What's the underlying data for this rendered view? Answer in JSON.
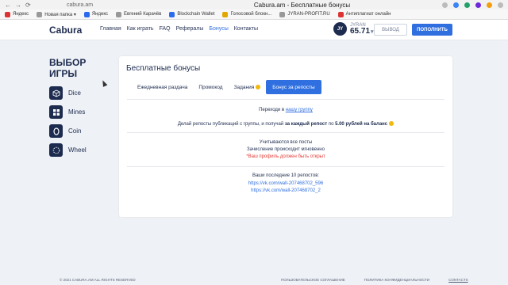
{
  "browser": {
    "back": "←",
    "forward": "→",
    "reload": "⟳",
    "url": "cabura.am",
    "title": "Cabura.am - Бесплатные бонусы"
  },
  "bookmarks": [
    {
      "label": "Яндекс",
      "color": "#d33"
    },
    {
      "label": "Новая папка ▾",
      "color": "#999"
    },
    {
      "label": "Яндекс",
      "color": "#2c6bed"
    },
    {
      "label": "Евгений Карачёв",
      "color": "#999"
    },
    {
      "label": "Blockchain Wallet",
      "color": "#2c6bed"
    },
    {
      "label": "Голосовой блокн...",
      "color": "#e0a800"
    },
    {
      "label": "JYRAN-PROFIT.RU",
      "color": "#999"
    },
    {
      "label": "Антиплагиат онлайн",
      "color": "#d33"
    }
  ],
  "header": {
    "logo": "Cabura",
    "nav": [
      "Главная",
      "Как играть",
      "FAQ",
      "Рефералы",
      "Бонусы",
      "Контакты"
    ],
    "active_nav": "Бонусы",
    "user": {
      "avatar": "JY",
      "name": "JYRAN",
      "balance": "65.71",
      "caret": "▾"
    },
    "logout_label": "ВЫВОД",
    "deposit_label": "ПОПОЛНИТЬ"
  },
  "sidebar": {
    "title": "ВЫБОР ИГРЫ",
    "games": [
      {
        "label": "Dice",
        "icon": "cube-icon"
      },
      {
        "label": "Mines",
        "icon": "grid-icon"
      },
      {
        "label": "Coin",
        "icon": "coin-icon"
      },
      {
        "label": "Wheel",
        "icon": "wheel-icon"
      }
    ]
  },
  "bonuses": {
    "title": "Бесплатные бонусы",
    "tabs": [
      "Ежедневная раздача",
      "Промокод",
      "Задания",
      "Бонус за репосты"
    ],
    "active_tab": "Бонус за репосты",
    "goto_prefix": "Переходи в",
    "goto_link": "нашу группу",
    "repost_prefix": "Делай репосты публикаций с группы, и получай",
    "repost_bold": "за каждый репост",
    "repost_mid": "по",
    "repost_amount": "5.00 рублей на баланс",
    "rule1": "Учитываются все посты",
    "rule2": "Зачисление происходит мгновенно",
    "rule3": "*Ваш профиль должен быть открыт",
    "reposts_title": "Ваши последние 10 репостов:",
    "reposts": [
      "https://vk.com/wall-207468702_596",
      "https://vk.com/wall-207468702_2"
    ]
  },
  "footer": {
    "copyright": "© 2021 CABURA.AM ALL RIGHTS RESERVED",
    "links": [
      "ПОЛЬЗОВАТЕЛЬСКОЕ СОГЛАШЕНИЕ",
      "ПОЛИТИКА КОНФИДЕНЦИАЛЬНОСТИ",
      "CONTACTS"
    ]
  },
  "colors": {
    "accent": "#2f6fe0",
    "dark": "#1d2b4f",
    "warning": "#e53935",
    "coin": "#f0b90b"
  }
}
